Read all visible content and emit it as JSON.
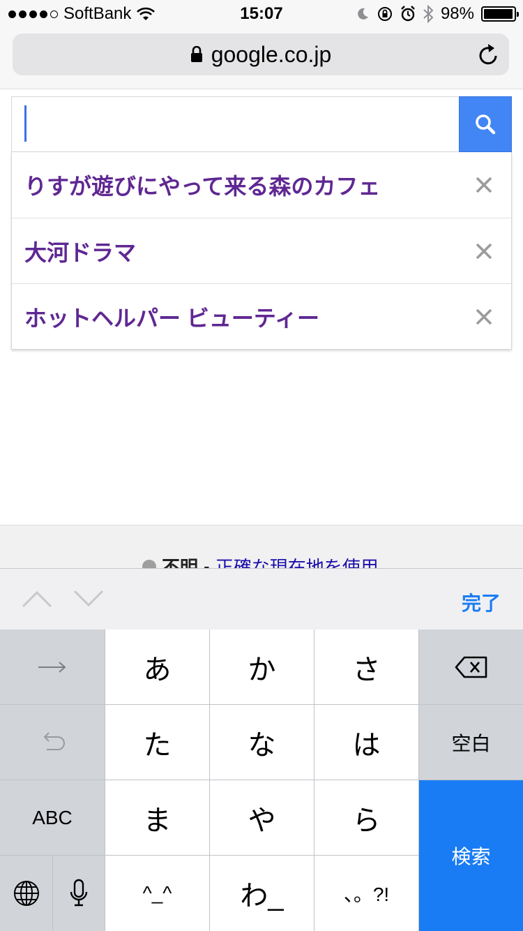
{
  "status_bar": {
    "carrier": "SoftBank",
    "time": "15:07",
    "battery": "98%",
    "battery_level": 0.98,
    "signal_dots_filled": 4,
    "signal_dots_total": 5
  },
  "url_bar": {
    "domain": "google.co.jp",
    "lock_icon": "lock-icon",
    "reload_icon": "reload-icon"
  },
  "search": {
    "value": "",
    "button_icon": "search-icon",
    "accent": "#4285f4"
  },
  "suggestions": [
    {
      "text": "りすが遊びにやって来る森のカフェ"
    },
    {
      "text": "大河ドラマ"
    },
    {
      "text": "ホットヘルパー ビューティー"
    }
  ],
  "suggestion_color": "#5f2792",
  "location": {
    "label": "不明",
    "separator": "-",
    "link": "正確な現在地を使用"
  },
  "accessory": {
    "done": "完了"
  },
  "keyboard": {
    "keys": {
      "a": "あ",
      "ka": "か",
      "sa": "さ",
      "ta": "た",
      "na": "な",
      "ha": "は",
      "ma": "ま",
      "ya": "や",
      "ra": "ら",
      "emoticon": "^_^",
      "wa": "わ_",
      "punct": "、。?!",
      "space": "空白",
      "abc": "ABC",
      "search": "検索"
    },
    "accent": "#1a7cf4"
  }
}
